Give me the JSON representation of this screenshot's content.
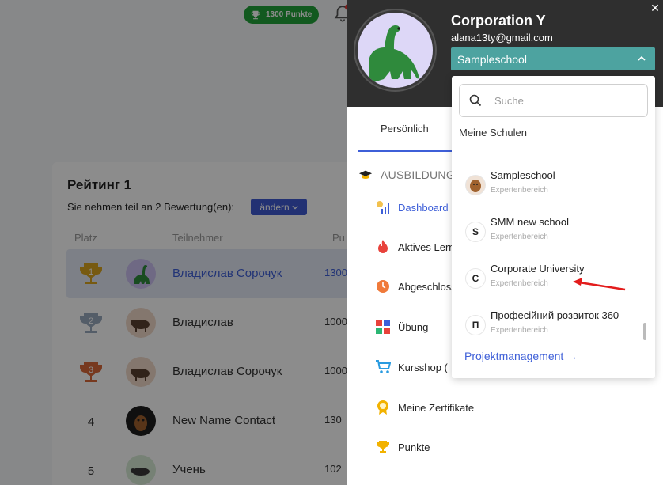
{
  "header": {
    "points_badge": "1300 Punkte"
  },
  "rating": {
    "title": "Рейтинг 1",
    "subtitle": "Sie nehmen teil an 2 Bewertung(en):",
    "change_label": "ändern",
    "columns": {
      "place": "Platz",
      "participant": "Teilnehmer",
      "points": "Pu"
    },
    "rows": [
      {
        "place": "1",
        "name": "Владислав Сорочук",
        "points": "1300"
      },
      {
        "place": "2",
        "name": "Владислав",
        "points": "1000"
      },
      {
        "place": "3",
        "name": "Владислав Сорочук",
        "points": "1000"
      },
      {
        "place": "4",
        "name": "New Name Contact",
        "points": "130"
      },
      {
        "place": "5",
        "name": "Учень",
        "points": "102"
      }
    ]
  },
  "panel": {
    "org_name": "Corporation Y",
    "email": "alana13ty@gmail.com",
    "selected_school": "Sampleschool",
    "tab_personal": "Persönlich",
    "section_title": "AUSBILDUNG",
    "menu": [
      {
        "label": "Dashboard",
        "icon": "dashboard-icon"
      },
      {
        "label": "Aktives Lernen",
        "icon": "flame-icon"
      },
      {
        "label": "Abgeschlossen",
        "icon": "clock-icon"
      },
      {
        "label": "Übung",
        "icon": "grid-icon"
      },
      {
        "label": "Kursshop (",
        "icon": "cart-icon"
      },
      {
        "label": "Meine Zertifikate",
        "icon": "award-icon"
      },
      {
        "label": "Punkte",
        "icon": "trophy-icon"
      }
    ]
  },
  "dropdown": {
    "search_placeholder": "Suche",
    "label": "Meine Schulen",
    "schools": [
      {
        "name": "Sampleschool",
        "role": "Expertenbereich",
        "initial": ""
      },
      {
        "name": "SMM new school",
        "role": "Expertenbereich",
        "initial": "S"
      },
      {
        "name": "Corporate University",
        "role": "Expertenbereich",
        "initial": "C"
      },
      {
        "name": "Професійний розвиток 360",
        "role": "Expertenbereich",
        "initial": "П"
      }
    ],
    "link": "Projektmanagement →"
  },
  "colors": {
    "accent_blue": "#3e5fd8",
    "teal_select": "#4da3a0",
    "points_green": "#22a339",
    "panel_dark": "#2f2f2f"
  }
}
